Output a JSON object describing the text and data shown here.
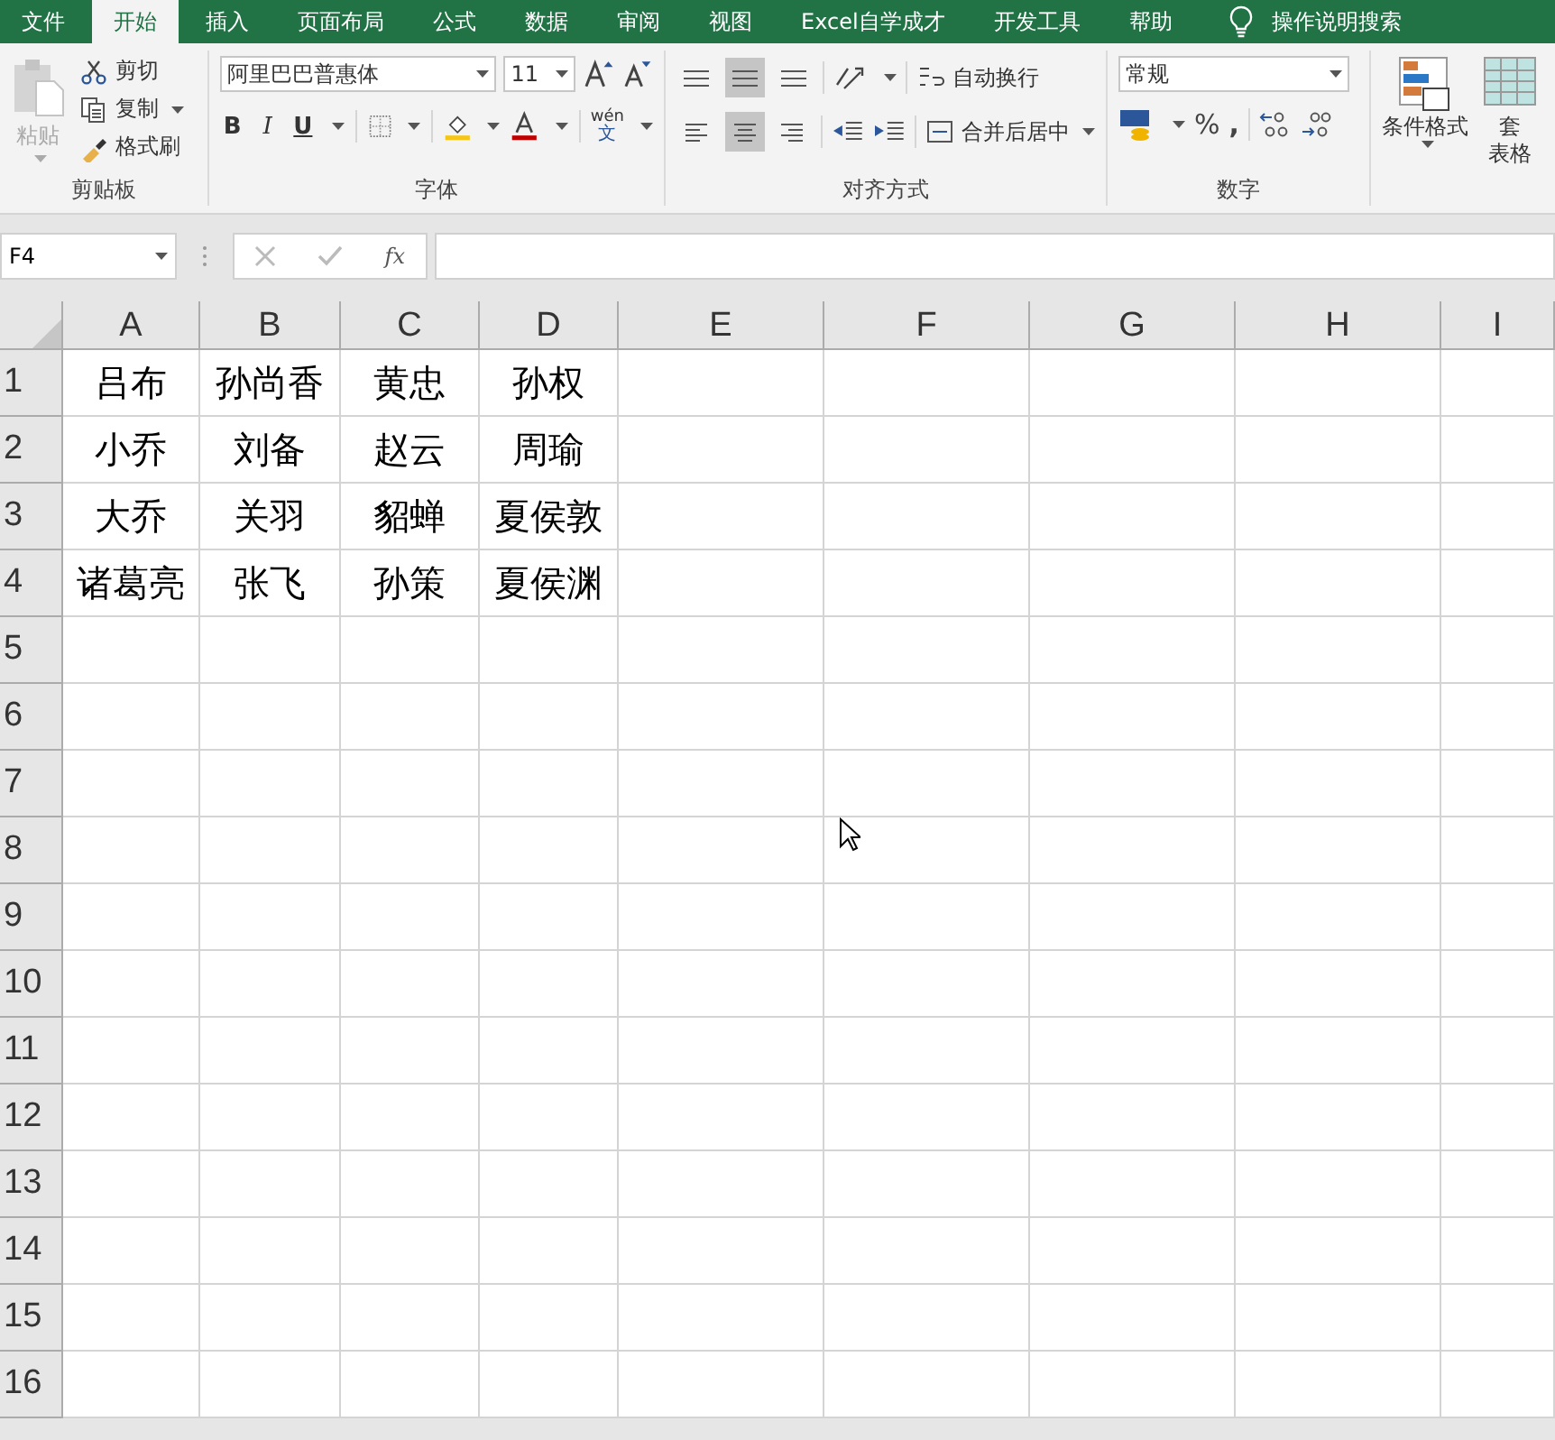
{
  "tabs": [
    {
      "label": "文件",
      "selected": false
    },
    {
      "label": "开始",
      "selected": true
    },
    {
      "label": "插入",
      "selected": false
    },
    {
      "label": "页面布局",
      "selected": false
    },
    {
      "label": "公式",
      "selected": false
    },
    {
      "label": "数据",
      "selected": false
    },
    {
      "label": "审阅",
      "selected": false
    },
    {
      "label": "视图",
      "selected": false
    },
    {
      "label": "Excel自学成才",
      "selected": false
    },
    {
      "label": "开发工具",
      "selected": false
    },
    {
      "label": "帮助",
      "selected": false
    }
  ],
  "tell_me": "操作说明搜索",
  "clipboard": {
    "paste": "粘贴",
    "cut": "剪切",
    "copy": "复制",
    "format_painter": "格式刷",
    "label": "剪贴板"
  },
  "font": {
    "font_name": "阿里巴巴普惠体",
    "font_size": "11",
    "bold": "B",
    "italic": "I",
    "underline": "U",
    "phonetic_top": "wén",
    "phonetic_bottom": "文",
    "label": "字体"
  },
  "alignment": {
    "vertical": [
      {
        "selected": false
      },
      {
        "selected": true
      },
      {
        "selected": false
      }
    ],
    "horizontal": [
      {
        "selected": false
      },
      {
        "selected": true
      },
      {
        "selected": false
      }
    ],
    "wrap_text": "自动换行",
    "merge_center": "合并后居中",
    "label": "对齐方式"
  },
  "number": {
    "format": "常规",
    "percent": "%",
    "comma": ",",
    "label": "数字"
  },
  "styles": {
    "conditional_formatting": "条件格式",
    "table_format_top": "套",
    "table_format_bottom": "表格"
  },
  "formula_bar": {
    "name_box": "F4",
    "fx": "fx"
  },
  "sheet": {
    "columns": [
      "A",
      "B",
      "C",
      "D",
      "E",
      "F",
      "G",
      "H",
      "I"
    ],
    "rows": [
      {
        "header": "1",
        "cells": [
          "吕布",
          "孙尚香",
          "黄忠",
          "孙权"
        ]
      },
      {
        "header": "2",
        "cells": [
          "小乔",
          "刘备",
          "赵云",
          "周瑜"
        ]
      },
      {
        "header": "3",
        "cells": [
          "大乔",
          "关羽",
          "貂蝉",
          "夏侯敦"
        ]
      },
      {
        "header": "4",
        "cells": [
          "诸葛亮",
          "张飞",
          "孙策",
          "夏侯渊"
        ]
      },
      {
        "header": "5",
        "cells": []
      },
      {
        "header": "6",
        "cells": []
      },
      {
        "header": "7",
        "cells": []
      },
      {
        "header": "8",
        "cells": []
      },
      {
        "header": "9",
        "cells": []
      },
      {
        "header": "10",
        "cells": []
      },
      {
        "header": "11",
        "cells": []
      },
      {
        "header": "12",
        "cells": []
      },
      {
        "header": "13",
        "cells": []
      },
      {
        "header": "14",
        "cells": []
      },
      {
        "header": "15",
        "cells": []
      },
      {
        "header": "16",
        "cells": []
      }
    ]
  }
}
